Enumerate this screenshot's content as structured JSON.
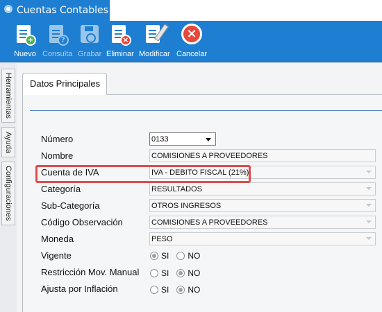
{
  "window": {
    "title": "Cuentas Contables"
  },
  "toolbar": {
    "buttons": [
      {
        "label": "Nuevo",
        "icon": "document-add-icon",
        "enabled": true
      },
      {
        "label": "Consulta",
        "icon": "document-query-icon",
        "enabled": false
      },
      {
        "label": "Grabar",
        "icon": "floppy-disk-icon",
        "enabled": false
      },
      {
        "label": "Eliminar",
        "icon": "document-delete-icon",
        "enabled": true
      },
      {
        "label": "Modificar",
        "icon": "document-edit-icon",
        "enabled": true
      },
      {
        "label": "Cancelar",
        "icon": "cancel-icon",
        "enabled": true
      }
    ]
  },
  "side_tabs": [
    "Herramientas",
    "Ayuda",
    "Configuraciones"
  ],
  "tabs": {
    "main": "Datos Principales"
  },
  "form": {
    "numero": {
      "label": "Número",
      "value": "0133"
    },
    "nombre": {
      "label": "Nombre",
      "value": "COMISIONES A PROVEEDORES"
    },
    "cuenta_iva": {
      "label": "Cuenta de IVA",
      "value": "IVA - DEBITO FISCAL (21%)"
    },
    "categoria": {
      "label": "Categoría",
      "value": "RESULTADOS"
    },
    "subcategoria": {
      "label": "Sub-Categoría",
      "value": "OTROS INGRESOS"
    },
    "codigo_obs": {
      "label": "Código Observación",
      "value": "COMISIONES A PROVEEDORES"
    },
    "moneda": {
      "label": "Moneda",
      "value": "PESO"
    },
    "vigente": {
      "label": "Vigente",
      "selected": "SI"
    },
    "restriccion": {
      "label": "Restricción Mov. Manual",
      "selected": "NO"
    },
    "ajusta": {
      "label": "Ajusta por Inflación",
      "selected": "NO"
    },
    "radio_options": {
      "si": "SI",
      "no": "NO"
    }
  },
  "colors": {
    "accent": "#1e7fd2",
    "highlight": "#e14b4b"
  }
}
